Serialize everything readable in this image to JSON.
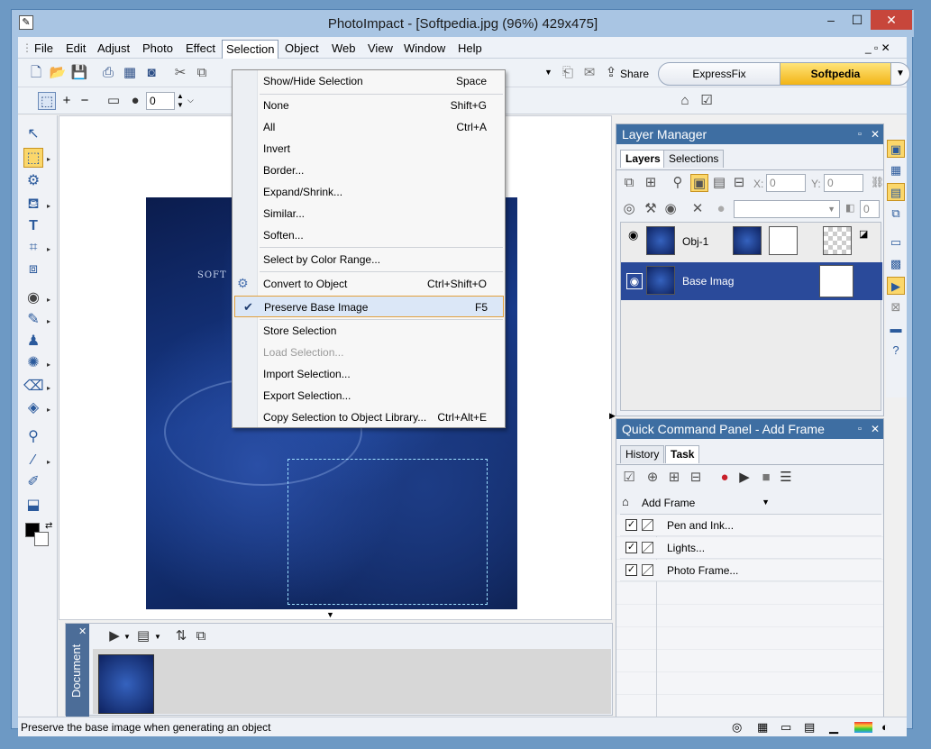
{
  "window": {
    "title": "PhotoImpact - [Softpedia.jpg (96%) 429x475]",
    "minimize": "–",
    "maximize": "☐",
    "close": "✕"
  },
  "menubar": {
    "items": [
      "File",
      "Edit",
      "Adjust",
      "Photo",
      "Effect",
      "Selection",
      "Object",
      "Web",
      "View",
      "Window",
      "Help"
    ],
    "active": "Selection",
    "mdi_controls": "_ ▫ ✕"
  },
  "toolbar": {
    "share_label": "Share",
    "expressfix_label": "ExpressFix",
    "softpedia_label": "Softpedia",
    "spinner_value": "0"
  },
  "selection_menu": [
    {
      "label": "Show/Hide Selection",
      "shortcut": "Space"
    },
    {
      "label": "None",
      "shortcut": "Shift+G"
    },
    {
      "label": "All",
      "shortcut": "Ctrl+A"
    },
    {
      "label": "Invert",
      "shortcut": ""
    },
    {
      "label": "Border...",
      "shortcut": ""
    },
    {
      "label": "Expand/Shrink...",
      "shortcut": ""
    },
    {
      "label": "Similar...",
      "shortcut": ""
    },
    {
      "label": "Soften...",
      "shortcut": ""
    },
    {
      "label": "Select by Color Range...",
      "shortcut": ""
    },
    {
      "label": "Convert to Object",
      "shortcut": "Ctrl+Shift+O"
    },
    {
      "label": "Preserve Base Image",
      "shortcut": "F5"
    },
    {
      "label": "Store Selection",
      "shortcut": ""
    },
    {
      "label": "Load Selection...",
      "shortcut": ""
    },
    {
      "label": "Import Selection...",
      "shortcut": ""
    },
    {
      "label": "Export Selection...",
      "shortcut": ""
    },
    {
      "label": "Copy Selection to Object Library...",
      "shortcut": "Ctrl+Alt+E"
    }
  ],
  "canvas": {
    "label": "SOFT"
  },
  "document_panel": {
    "tab_label": "Document"
  },
  "layer_manager": {
    "title": "Layer Manager",
    "tabs": [
      "Layers",
      "Selections"
    ],
    "x_label": "X:",
    "x_value": "0",
    "y_label": "Y:",
    "y_value": "0",
    "opacity_value": "0",
    "layers": [
      {
        "name": "Obj-1"
      },
      {
        "name": "Base Imag"
      }
    ]
  },
  "quick_command": {
    "title": "Quick Command Panel - Add Frame",
    "tabs": [
      "History",
      "Task"
    ],
    "dropdown_value": "Add Frame",
    "tasks": [
      "Pen and Ink...",
      "Lights...",
      "Photo Frame..."
    ]
  },
  "status": {
    "text": "Preserve the base image when generating an object"
  },
  "colors": {
    "panel_title": "#3e6ea2",
    "selected_layer": "#2a4a9a",
    "accent_orange": "#f2b416"
  }
}
